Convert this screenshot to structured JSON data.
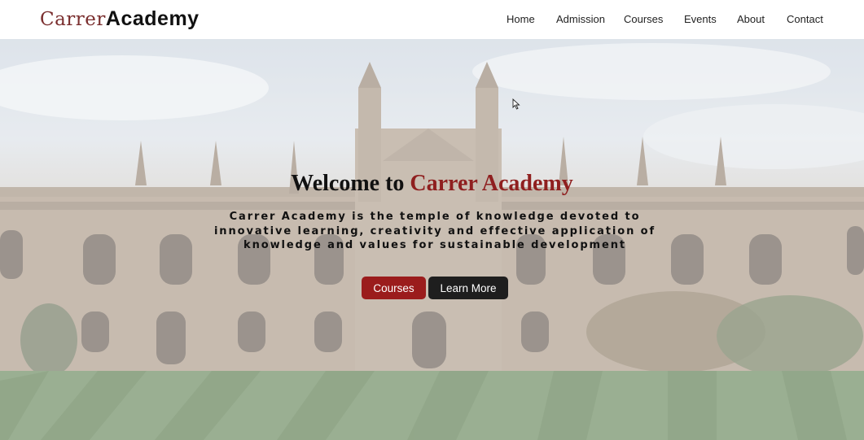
{
  "brand": {
    "part1": "Carrer",
    "part2": "Academy"
  },
  "nav": {
    "items": [
      {
        "label": "Home"
      },
      {
        "label": "Admission"
      },
      {
        "label": "Courses"
      },
      {
        "label": "Events"
      },
      {
        "label": "About"
      },
      {
        "label": "Contact"
      }
    ]
  },
  "hero": {
    "title_prefix": "Welcome to ",
    "title_accent": "Carrer Academy",
    "subtitle": "Carrer Academy is the temple of knowledge devoted to innovative learning, creativity and effective application of knowledge and values for sustainable development",
    "primary_button": "Courses",
    "secondary_button": "Learn More"
  },
  "colors": {
    "brand_accent": "#7a2e2e",
    "title_accent": "#8f1f1f",
    "primary_button": "#9b1c1c",
    "secondary_button": "#1e1e1e"
  },
  "icons": {
    "cursor": "mouse-pointer-icon"
  }
}
